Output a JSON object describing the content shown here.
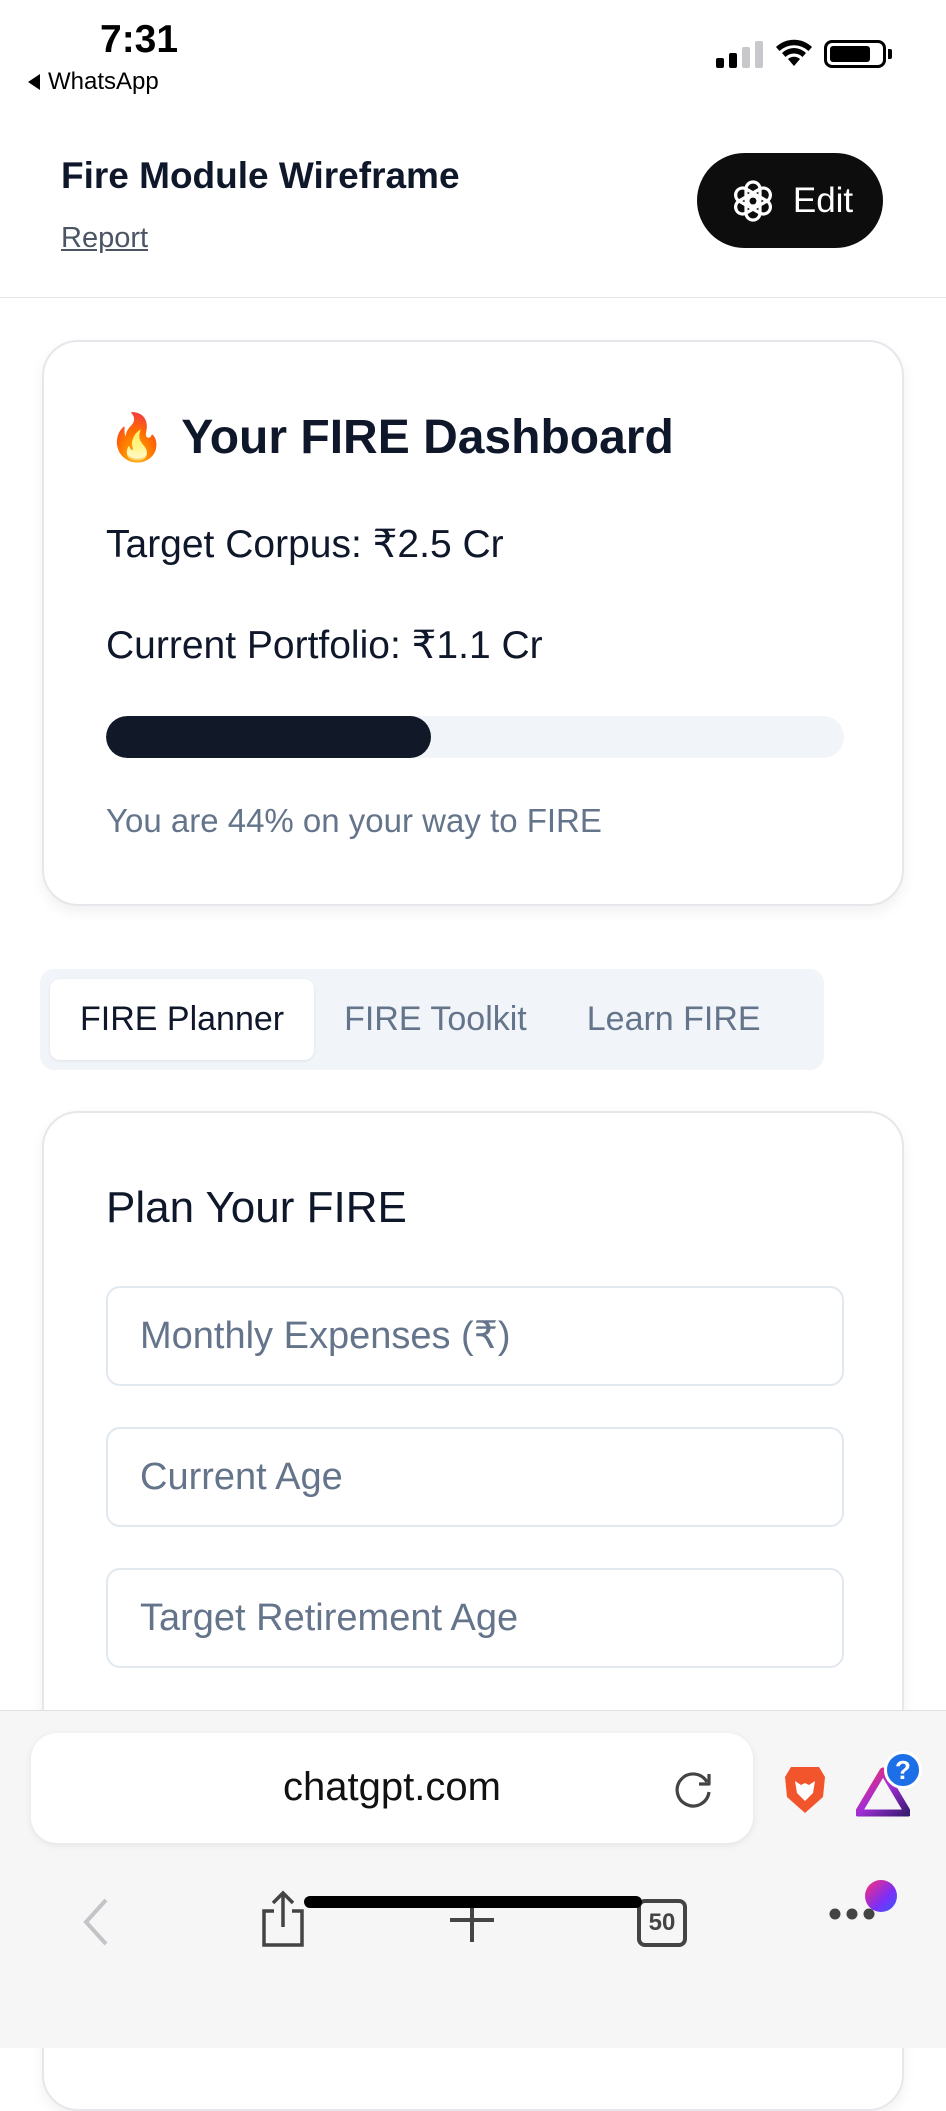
{
  "status_bar": {
    "time": "7:31",
    "back_app": "WhatsApp"
  },
  "header": {
    "title": "Fire Module Wireframe",
    "report_link": "Report",
    "edit_label": "Edit"
  },
  "dashboard": {
    "emoji": "🔥",
    "title": "Your FIRE Dashboard",
    "target_corpus": "Target Corpus: ₹2.5 Cr",
    "current_portfolio": "Current Portfolio: ₹1.1 Cr",
    "progress_fraction": 0.44,
    "progress_text": "You are 44% on your way to FIRE"
  },
  "tabs": [
    {
      "label": "FIRE Planner",
      "active": true
    },
    {
      "label": "FIRE Toolkit",
      "active": false
    },
    {
      "label": "Learn FIRE",
      "active": false
    }
  ],
  "planner": {
    "title": "Plan Your FIRE",
    "fields": [
      {
        "placeholder": "Monthly Expenses (₹)"
      },
      {
        "placeholder": "Current Age"
      },
      {
        "placeholder": "Target Retirement Age"
      }
    ]
  },
  "browser": {
    "url": "chatgpt.com",
    "tab_count": "50",
    "extension_badge": "?"
  },
  "icons": [
    "back-triangle-icon",
    "cellular-signal-icon",
    "wifi-icon",
    "battery-icon",
    "openai-logo-icon",
    "fire-emoji-icon",
    "reload-icon",
    "brave-lion-icon",
    "aurora-triangle-icon",
    "chevron-left-icon",
    "share-icon",
    "plus-icon",
    "tabs-icon",
    "more-dots-icon"
  ]
}
